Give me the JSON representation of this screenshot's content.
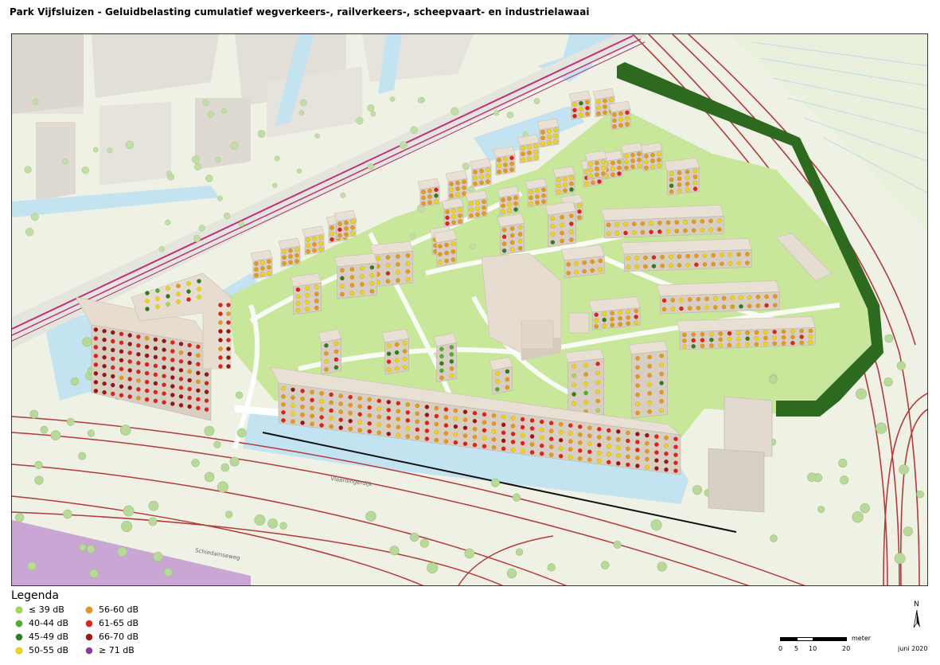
{
  "title": "Park Vijfsluizen - Geluidbelasting cumulatief wegverkeers-, railverkeers-, scheepvaart- en industrielawaai",
  "map": {
    "street_labels": [
      "Vlaardingerdijk",
      "Schiedamseweg"
    ]
  },
  "legend": {
    "title": "Legenda",
    "items": [
      {
        "label": "≤ 39 dB",
        "color": "#a6d84a"
      },
      {
        "label": "40-44 dB",
        "color": "#4caf2f"
      },
      {
        "label": "45-49 dB",
        "color": "#2e7d1e"
      },
      {
        "label": "50-55 dB",
        "color": "#f2d60c"
      },
      {
        "label": "56-60 dB",
        "color": "#e89a17"
      },
      {
        "label": "61-65 dB",
        "color": "#e32117"
      },
      {
        "label": "66-70 dB",
        "color": "#9c1414"
      },
      {
        "label": "≥ 71 dB",
        "color": "#8b3aa0"
      }
    ]
  },
  "north_arrow": {
    "label": "N"
  },
  "scale_bar": {
    "ticks": [
      "0",
      "5",
      "10",
      "20"
    ],
    "unit": "meter"
  },
  "date": "juni 2020"
}
